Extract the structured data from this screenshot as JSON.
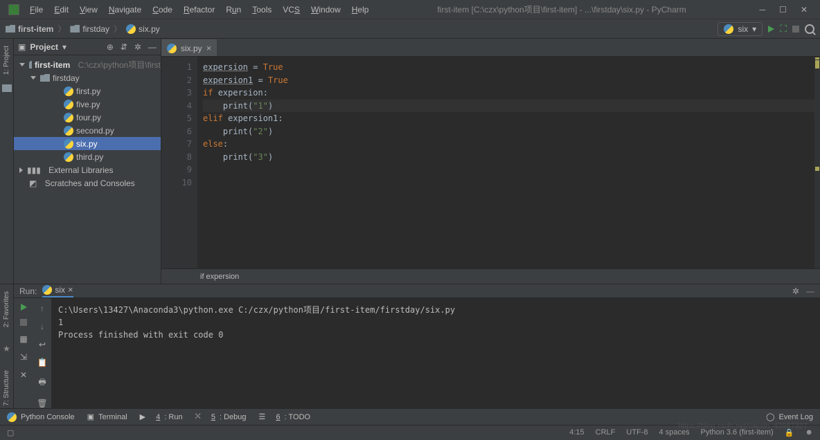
{
  "title": "first-item [C:\\czx\\python项目\\first-item] - ...\\firstday\\six.py - PyCharm",
  "menu": [
    "File",
    "Edit",
    "View",
    "Navigate",
    "Code",
    "Refactor",
    "Run",
    "Tools",
    "VCS",
    "Window",
    "Help"
  ],
  "breadcrumbs": {
    "root": "first-item",
    "folder": "firstday",
    "file": "six.py"
  },
  "run_config": "six",
  "project_panel": {
    "title": "Project",
    "root": {
      "name": "first-item",
      "path": "C:\\czx\\python项目\\first"
    },
    "folder": "firstday",
    "files": [
      "first.py",
      "five.py",
      "four.py",
      "second.py",
      "six.py",
      "third.py"
    ],
    "ext_lib": "External Libraries",
    "scratches": "Scratches and Consoles"
  },
  "editor": {
    "tab": "six.py",
    "lines": [
      "1",
      "2",
      "3",
      "4",
      "5",
      "6",
      "7",
      "8",
      "9",
      "10"
    ],
    "code": {
      "l1a": "expersion",
      "l1b": " = ",
      "l1c": "True",
      "l2a": "expersion1",
      "l2b": " = ",
      "l2c": "True",
      "l3a": "if ",
      "l3b": "expersion:",
      "l4a": "    print",
      "l4b": "(",
      "l4c": "\"1\"",
      "l4d": ")",
      "l5a": "elif ",
      "l5b": "expersion1:",
      "l6a": "    print",
      "l6b": "(",
      "l6c": "\"2\"",
      "l6d": ")",
      "l7a": "else",
      "l7b": ":",
      "l8a": "    print",
      "l8b": "(",
      "l8c": "\"3\"",
      "l8d": ")"
    },
    "breadcrumb": "if expersion"
  },
  "run": {
    "label": "Run:",
    "tab": "six",
    "out1": "C:\\Users\\13427\\Anaconda3\\python.exe C:/czx/python项目/first-item/firstday/six.py",
    "out2": "1",
    "out3": "",
    "out4": "Process finished with exit code 0"
  },
  "bottom_tabs": {
    "console": "Python Console",
    "terminal": "Terminal",
    "run_n": "4",
    "run_t": ": Run",
    "debug_n": "5",
    "debug_t": ": Debug",
    "todo_n": "6",
    "todo_t": ": TODO",
    "event_log": "Event Log"
  },
  "side_tabs": {
    "project": "1: Project",
    "favorites": "2: Favorites",
    "structure": "7: Structure"
  },
  "status": {
    "pos": "4:15",
    "le": "CRLF",
    "enc": "UTF-8",
    "indent": "4 spaces",
    "interp": "Python 3.6 (first-item)",
    "watermark": "https://blog.csdn.net/weixin_43987327"
  }
}
